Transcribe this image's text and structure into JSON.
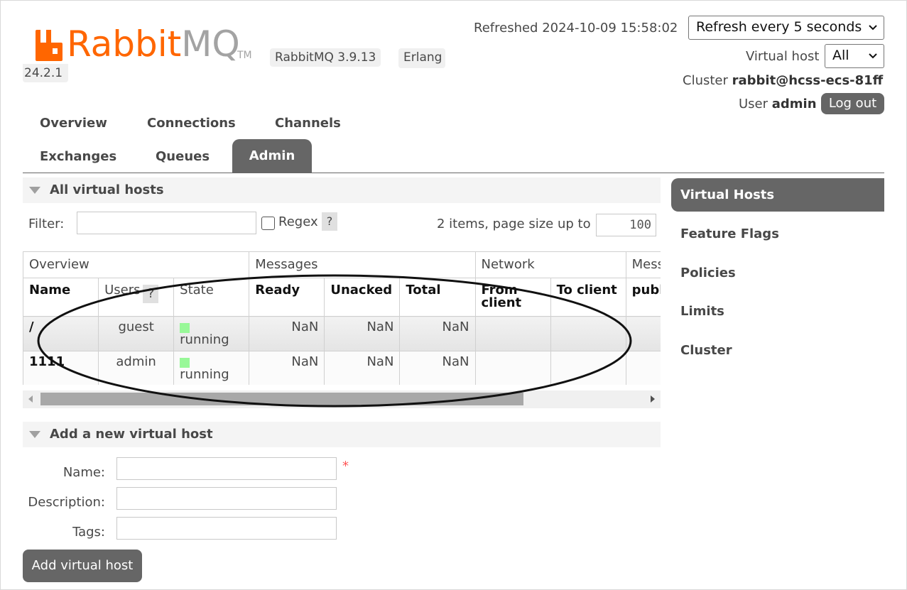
{
  "header": {
    "logo_rabbit": "Rabbit",
    "logo_mq": "MQ",
    "logo_tm": "TM",
    "version_label": "RabbitMQ 3.9.13",
    "erlang_label": "Erlang",
    "erlang_version": "24.2.1",
    "refreshed_label": "Refreshed 2024-10-09 15:58:02",
    "refresh_select": "Refresh every 5 seconds",
    "vhost_label": "Virtual host",
    "vhost_select": "All",
    "cluster_label": "Cluster",
    "cluster_name": "rabbit@hcss-ecs-81ff",
    "user_label": "User",
    "user_name": "admin",
    "logout": "Log out"
  },
  "tabs": {
    "overview": "Overview",
    "connections": "Connections",
    "channels": "Channels",
    "exchanges": "Exchanges",
    "queues": "Queues",
    "admin": "Admin"
  },
  "vhosts": {
    "section_title": "All virtual hosts",
    "filter_label": "Filter:",
    "filter_value": "",
    "regex_label": "Regex",
    "help": "?",
    "items_label": "2 items, page size up to",
    "page_size": "100",
    "groups": [
      "Overview",
      "Messages",
      "Network",
      "Mess"
    ],
    "columns": {
      "name": "Name",
      "users": "Users",
      "state": "State",
      "ready": "Ready",
      "unacked": "Unacked",
      "total": "Total",
      "from_client": "From client",
      "to_client": "To client",
      "publish": "publi"
    },
    "rows": [
      {
        "name": "/",
        "users": "guest",
        "state": "running",
        "ready": "NaN",
        "unacked": "NaN",
        "total": "NaN"
      },
      {
        "name": "1111",
        "users": "admin",
        "state": "running",
        "ready": "NaN",
        "unacked": "NaN",
        "total": "NaN"
      }
    ]
  },
  "add_vhost": {
    "section_title": "Add a new virtual host",
    "name_label": "Name:",
    "description_label": "Description:",
    "tags_label": "Tags:",
    "required_mark": "*",
    "button": "Add virtual host"
  },
  "sidebar": {
    "items": [
      "Virtual Hosts",
      "Feature Flags",
      "Policies",
      "Limits",
      "Cluster"
    ]
  },
  "colors": {
    "brand_orange": "#ff6600",
    "accent_grey": "#666666",
    "running_green": "#98f898"
  }
}
